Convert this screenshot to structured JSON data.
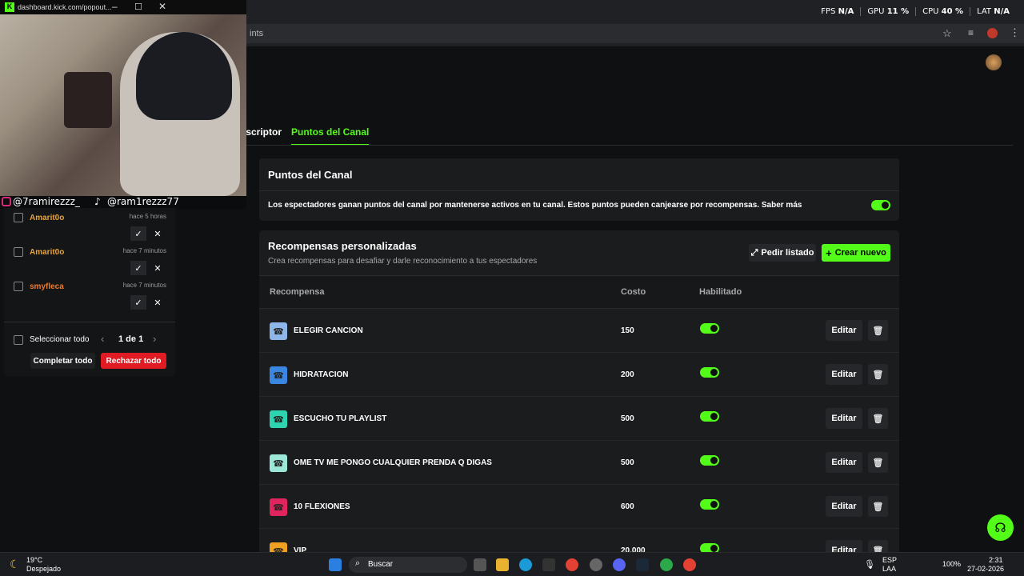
{
  "overlay_stats": {
    "fps_label": "FPS",
    "fps": "N/A",
    "gpu_label": "GPU",
    "gpu": "11 %",
    "cpu_label": "CPU",
    "cpu": "40 %",
    "lat_label": "LAT",
    "lat": "N/A"
  },
  "popout_window": {
    "title": "dashboard.kick.com/popout...",
    "favicon": "K"
  },
  "browser": {
    "address_fragment": "ints"
  },
  "socials": {
    "instagram": "@7ramirezzz_",
    "tiktok": "@ram1rezzz77"
  },
  "tabs": [
    {
      "label": "uscriptor"
    },
    {
      "label": "Puntos del Canal"
    }
  ],
  "channel_points": {
    "title": "Puntos del Canal",
    "description": "Los espectadores ganan puntos del canal por mantenerse activos en tu canal. Estos puntos pueden canjearse por recompensas. Saber más",
    "enabled": true
  },
  "rewards": {
    "title": "Recompensas personalizadas",
    "subtitle": "Crea recompensas para desafiar y darle reconocimiento a tus espectadores",
    "request_list_button": "Pedir listado",
    "create_button": "Crear nuevo",
    "columns": {
      "reward": "Recompensa",
      "cost": "Costo",
      "enabled": "Habilitado"
    },
    "edit_label": "Editar",
    "items": [
      {
        "name": "ELEGIR CANCION",
        "cost": "150",
        "color": "#8fb6e8"
      },
      {
        "name": "HIDRATACION",
        "cost": "200",
        "color": "#3a86e0"
      },
      {
        "name": "ESCUCHO TU PLAYLIST",
        "cost": "500",
        "color": "#2ed3b0"
      },
      {
        "name": "OME TV ME PONGO CUALQUIER PRENDA Q DIGAS",
        "cost": "500",
        "color": "#9be8d8"
      },
      {
        "name": "10 FLEXIONES",
        "cost": "600",
        "color": "#e0245e"
      },
      {
        "name": "VIP",
        "cost": "20.000",
        "color": "#f0a020"
      }
    ]
  },
  "redemptions": {
    "items": [
      {
        "user": "Amarit0o",
        "time": "hace 5 horas",
        "color": "#e8a23a"
      },
      {
        "user": "Amarit0o",
        "time": "hace 7 minutos",
        "color": "#e8a23a"
      },
      {
        "user": "smyfleca",
        "time": "hace 7 minutos",
        "color": "#f07a2a"
      }
    ],
    "select_all": "Seleccionar todo",
    "pagination": "1 de 1",
    "complete_all": "Completar todo",
    "reject_all": "Rechazar todo"
  },
  "taskbar": {
    "weather_temp": "19°C",
    "weather_desc": "Despejado",
    "search": "Buscar",
    "lang": "ESP",
    "lang2": "LAA",
    "battery": "100%",
    "time": "2:31",
    "date": "27-02-2026"
  }
}
